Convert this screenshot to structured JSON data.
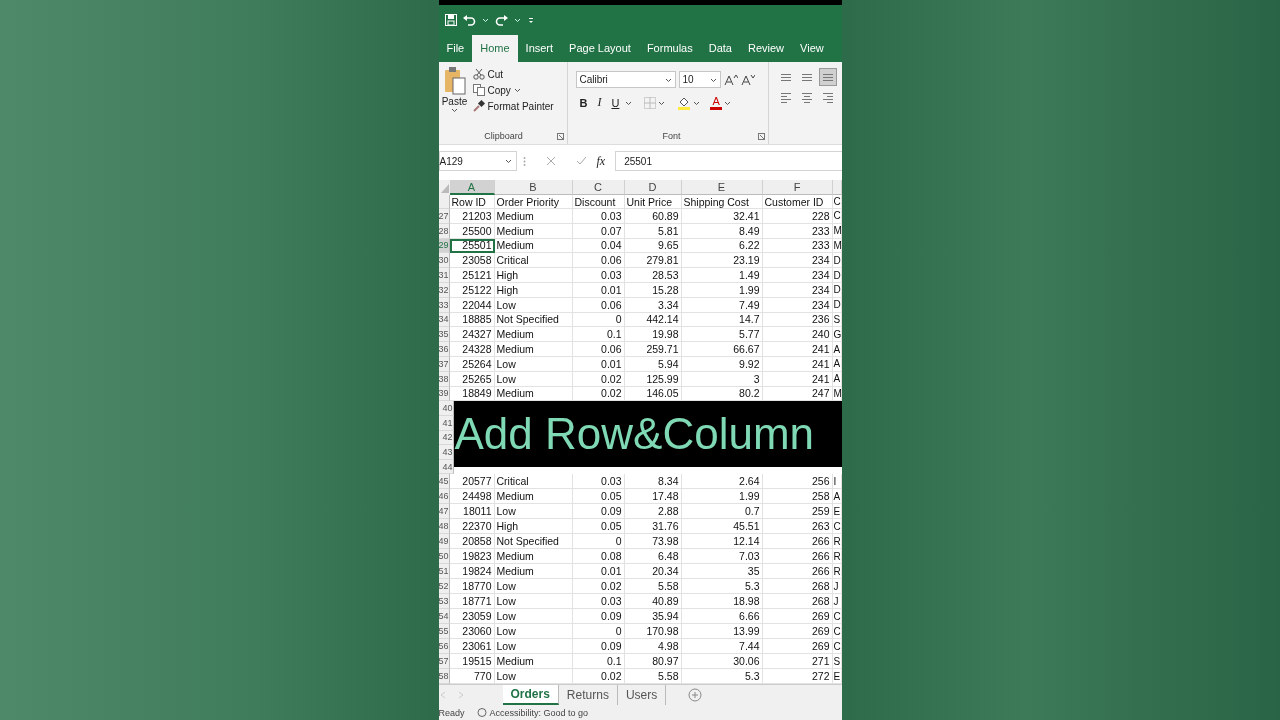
{
  "ribbon_tabs": [
    {
      "label": "File",
      "selected": false
    },
    {
      "label": "Home",
      "selected": true
    },
    {
      "label": "Insert",
      "selected": false
    },
    {
      "label": "Page Layout",
      "selected": false
    },
    {
      "label": "Formulas",
      "selected": false
    },
    {
      "label": "Data",
      "selected": false
    },
    {
      "label": "Review",
      "selected": false
    },
    {
      "label": "View",
      "selected": false
    }
  ],
  "clipboard": {
    "paste": "Paste",
    "cut": "Cut",
    "copy": "Copy",
    "format_painter": "Format Painter",
    "label": "Clipboard"
  },
  "font": {
    "name": "Calibri",
    "size": "10",
    "bold": "B",
    "italic": "I",
    "underline": "U",
    "font_color": "A",
    "label": "Font"
  },
  "alignment_buttons": [
    {
      "selected": false
    },
    {
      "selected": false
    },
    {
      "selected": true
    },
    {
      "selected": false
    },
    {
      "selected": false
    },
    {
      "selected": false
    }
  ],
  "formula_bar": {
    "name_box": "A129",
    "fx": "fx",
    "value": "25501"
  },
  "columns": [
    {
      "label": "A",
      "selected": true
    },
    {
      "label": "B",
      "selected": false
    },
    {
      "label": "C",
      "selected": false
    },
    {
      "label": "D",
      "selected": false
    },
    {
      "label": "E",
      "selected": false
    },
    {
      "label": "F",
      "selected": false
    }
  ],
  "header_row": [
    "Row ID",
    "Order Priority",
    "Discount",
    "Unit Price",
    "Shipping Cost",
    "Customer ID",
    "C"
  ],
  "rows": [
    {
      "number": "27",
      "selected": false,
      "cells": [
        "21203",
        "Medium",
        "0.03",
        "60.89",
        "32.41",
        "228",
        "C"
      ]
    },
    {
      "number": "28",
      "selected": false,
      "cells": [
        "25500",
        "Medium",
        "0.07",
        "5.81",
        "8.49",
        "233",
        "M"
      ]
    },
    {
      "number": "29",
      "selected": true,
      "cells": [
        "25501",
        "Medium",
        "0.04",
        "9.65",
        "6.22",
        "233",
        "M"
      ]
    },
    {
      "number": "30",
      "selected": false,
      "cells": [
        "23058",
        "Critical",
        "0.06",
        "279.81",
        "23.19",
        "234",
        "D"
      ]
    },
    {
      "number": "31",
      "selected": false,
      "cells": [
        "25121",
        "High",
        "0.03",
        "28.53",
        "1.49",
        "234",
        "D"
      ]
    },
    {
      "number": "32",
      "selected": false,
      "cells": [
        "25122",
        "High",
        "0.01",
        "15.28",
        "1.99",
        "234",
        "D"
      ]
    },
    {
      "number": "33",
      "selected": false,
      "cells": [
        "22044",
        "Low",
        "0.06",
        "3.34",
        "7.49",
        "234",
        "D"
      ]
    },
    {
      "number": "34",
      "selected": false,
      "cells": [
        "18885",
        "Not Specified",
        "0",
        "442.14",
        "14.7",
        "236",
        "S"
      ]
    },
    {
      "number": "35",
      "selected": false,
      "cells": [
        "24327",
        "Medium",
        "0.1",
        "19.98",
        "5.77",
        "240",
        "G"
      ]
    },
    {
      "number": "36",
      "selected": false,
      "cells": [
        "24328",
        "Medium",
        "0.06",
        "259.71",
        "66.67",
        "241",
        "A"
      ]
    },
    {
      "number": "37",
      "selected": false,
      "cells": [
        "25264",
        "Low",
        "0.01",
        "5.94",
        "9.92",
        "241",
        "A"
      ]
    },
    {
      "number": "38",
      "selected": false,
      "cells": [
        "25265",
        "Low",
        "0.02",
        "125.99",
        "3",
        "241",
        "A"
      ]
    },
    {
      "number": "39",
      "selected": false,
      "cells": [
        "18849",
        "Medium",
        "0.02",
        "146.05",
        "80.2",
        "247",
        "M"
      ]
    }
  ],
  "covered_rows": [
    "40",
    "41",
    "42",
    "43",
    "44"
  ],
  "caption": "Add Row&Column",
  "rows_after": [
    {
      "number": "45",
      "selected": false,
      "cells": [
        "20577",
        "Critical",
        "0.03",
        "8.34",
        "2.64",
        "256",
        "I"
      ]
    },
    {
      "number": "46",
      "selected": false,
      "cells": [
        "24498",
        "Medium",
        "0.05",
        "17.48",
        "1.99",
        "258",
        "A"
      ]
    },
    {
      "number": "47",
      "selected": false,
      "cells": [
        "18011",
        "Low",
        "0.09",
        "2.88",
        "0.7",
        "259",
        "E"
      ]
    },
    {
      "number": "48",
      "selected": false,
      "cells": [
        "22370",
        "High",
        "0.05",
        "31.76",
        "45.51",
        "263",
        "C"
      ]
    },
    {
      "number": "49",
      "selected": false,
      "cells": [
        "20858",
        "Not Specified",
        "0",
        "73.98",
        "12.14",
        "266",
        "R"
      ]
    },
    {
      "number": "50",
      "selected": false,
      "cells": [
        "19823",
        "Medium",
        "0.08",
        "6.48",
        "7.03",
        "266",
        "R"
      ]
    },
    {
      "number": "51",
      "selected": false,
      "cells": [
        "19824",
        "Medium",
        "0.01",
        "20.34",
        "35",
        "266",
        "R"
      ]
    },
    {
      "number": "52",
      "selected": false,
      "cells": [
        "18770",
        "Low",
        "0.02",
        "5.58",
        "5.3",
        "268",
        "J"
      ]
    },
    {
      "number": "53",
      "selected": false,
      "cells": [
        "18771",
        "Low",
        "0.03",
        "40.89",
        "18.98",
        "268",
        "J"
      ]
    },
    {
      "number": "54",
      "selected": false,
      "cells": [
        "23059",
        "Low",
        "0.09",
        "35.94",
        "6.66",
        "269",
        "C"
      ]
    },
    {
      "number": "55",
      "selected": false,
      "cells": [
        "23060",
        "Low",
        "0",
        "170.98",
        "13.99",
        "269",
        "C"
      ]
    },
    {
      "number": "56",
      "selected": false,
      "cells": [
        "23061",
        "Low",
        "0.09",
        "4.98",
        "7.44",
        "269",
        "C"
      ]
    },
    {
      "number": "57",
      "selected": false,
      "cells": [
        "19515",
        "Medium",
        "0.1",
        "80.97",
        "30.06",
        "271",
        "S"
      ]
    },
    {
      "number": "58",
      "selected": false,
      "cells": [
        "770",
        "Low",
        "0.02",
        "5.58",
        "5.3",
        "272",
        "E"
      ]
    }
  ],
  "sheet_tabs": [
    {
      "label": "Orders",
      "selected": true
    },
    {
      "label": "Returns",
      "selected": false
    },
    {
      "label": "Users",
      "selected": false
    }
  ],
  "status_bar": {
    "ready": "Ready",
    "accessibility": "Accessibility: Good to go"
  }
}
